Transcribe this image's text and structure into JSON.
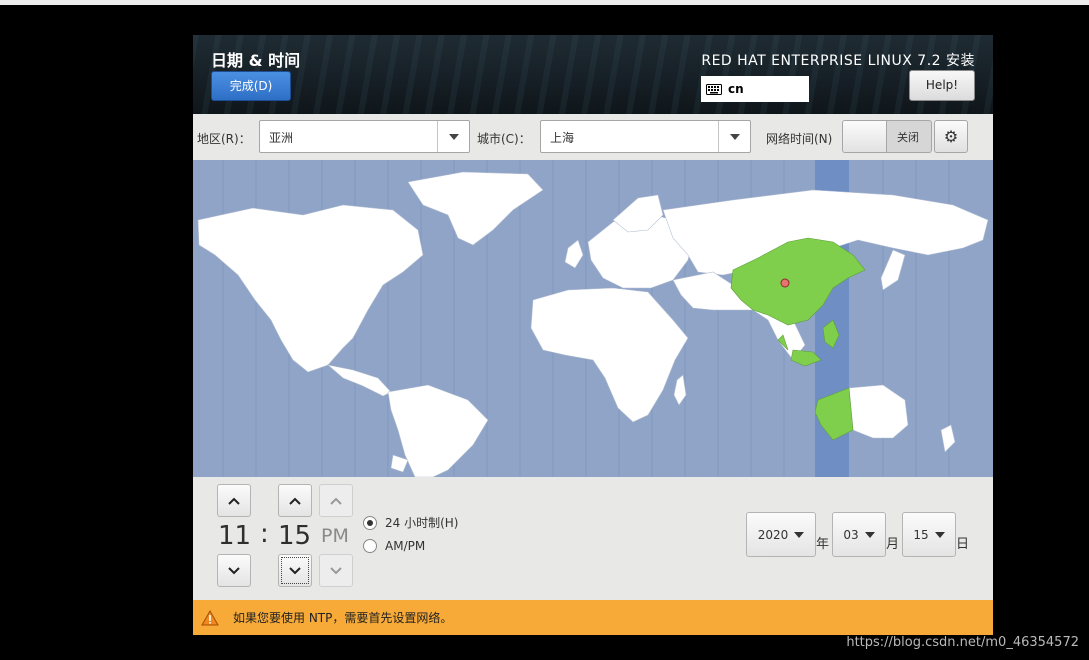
{
  "header": {
    "title": "日期 & 时间",
    "done_label": "完成(D)",
    "product": "RED HAT ENTERPRISE LINUX 7.2 安装",
    "keyboard_layout": "cn",
    "help_label": "Help!"
  },
  "toolbar": {
    "region_label": "地区(R)：",
    "region_value": "亚洲",
    "city_label": "城市(C)：",
    "city_value": "上海",
    "ntp_label": "网络时间(N)",
    "ntp_toggle_label": "关闭",
    "ntp_enabled": false
  },
  "time": {
    "hour": "11",
    "separator": ":",
    "minute": "15",
    "ampm": "PM",
    "format_24h_label": "24 小时制(H)",
    "format_ampm_label": "AM/PM",
    "selected_format": "24h"
  },
  "date": {
    "year": "2020",
    "year_label": "年",
    "month": "03",
    "month_label": "月",
    "day": "15",
    "day_label": "日"
  },
  "warning": {
    "text": "如果您要使用 NTP，需要首先设置网络。"
  },
  "watermark": "https://blog.csdn.net/m0_46354572",
  "colors": {
    "ocean": "#8fa4c6",
    "land": "#ffffff",
    "selected_zone": "#7fcf4d",
    "zone_stripe": "#6f8fc4",
    "warning_bar": "#f7aa37",
    "done_button": "#3a80d6"
  }
}
